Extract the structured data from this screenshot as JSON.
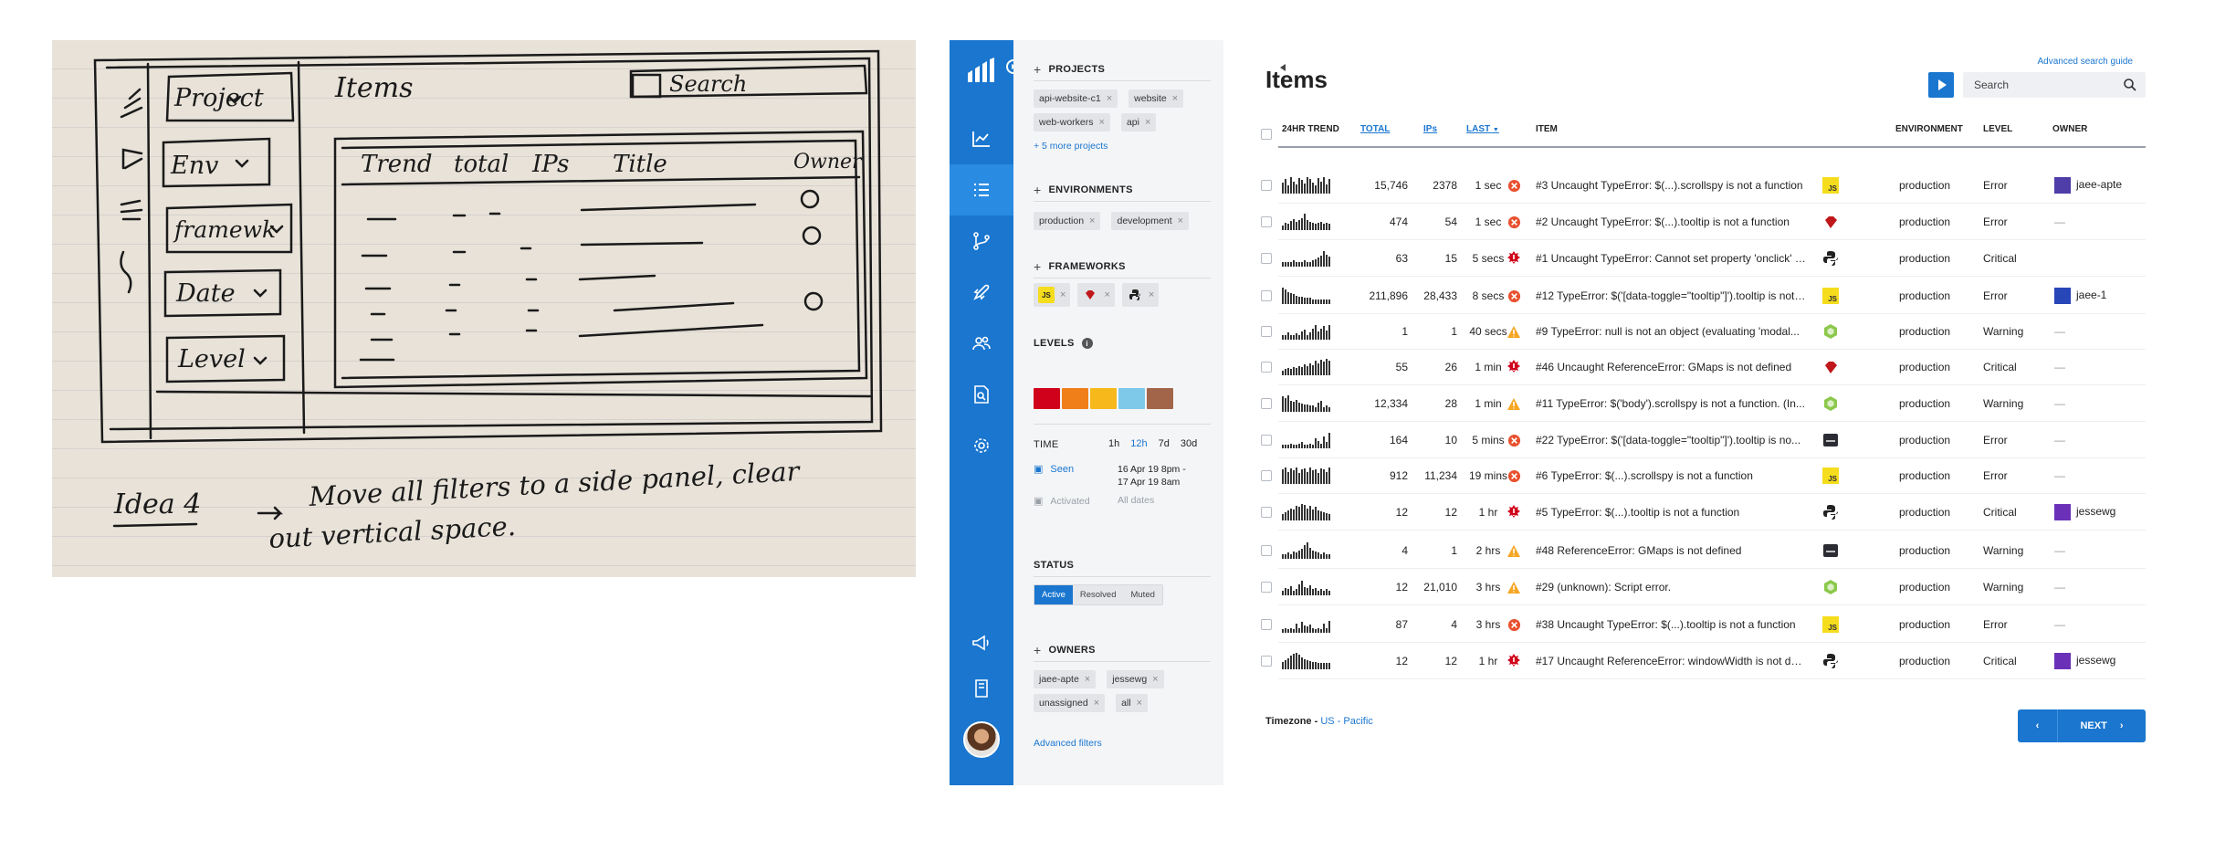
{
  "sketch": {
    "nav": [
      "Project",
      "Env",
      "framewk",
      "Date",
      "Level"
    ],
    "title": "Items",
    "search": "Search",
    "columns": [
      "Trend",
      "total",
      "IPs",
      "Title",
      "Owner"
    ],
    "idea_label": "Idea 4",
    "idea_line1": "Move all filters to a side panel, clear",
    "idea_line2": "out vertical space."
  },
  "filters": {
    "projects": {
      "title": "PROJECTS",
      "chips": [
        "api-website-c1",
        "website",
        "web-workers",
        "api"
      ],
      "more": "+ 5 more projects"
    },
    "environments": {
      "title": "ENVIRONMENTS",
      "chips": [
        "production",
        "development"
      ]
    },
    "frameworks": {
      "title": "FRAMEWORKS",
      "chips": [
        "js",
        "ruby",
        "python"
      ]
    },
    "levels": {
      "title": "LEVELS",
      "colors": [
        "#d0021b",
        "#f07f1a",
        "#f6b81b",
        "#7ec8ea",
        "#a3654a"
      ]
    },
    "time": {
      "title": "TIME",
      "options": [
        "1h",
        "12h",
        "7d",
        "30d"
      ],
      "seen_label": "Seen",
      "seen_from": "16 Apr 19  8pm -",
      "seen_to": "17 Apr 19  8am",
      "activated_label": "Activated",
      "activated_value": "All dates"
    },
    "status": {
      "title": "STATUS",
      "options": [
        "Active",
        "Resolved",
        "Muted"
      ]
    },
    "owners": {
      "title": "OWNERS",
      "chips": [
        "jaee-apte",
        "jessewg",
        "unassigned",
        "all"
      ]
    },
    "advanced": "Advanced filters"
  },
  "main": {
    "title": "Items",
    "advanced_guide": "Advanced search guide",
    "search_placeholder": "Search",
    "columns": {
      "trend": "24HR TREND",
      "total": "TOTAL",
      "ips": "IPs",
      "last": "LAST",
      "item": "ITEM",
      "environment": "ENVIRONMENT",
      "level": "LEVEL",
      "owner": "OWNER"
    },
    "rows": [
      {
        "total": "15,746",
        "ips": "2378",
        "last": "1 sec",
        "icon": "error",
        "title": "#3 Uncaught TypeError: $(...).scrollspy is not a function",
        "fw": "js",
        "env": "production",
        "level": "Error",
        "owner": "jaee-apte",
        "trend": [
          9,
          12,
          6,
          14,
          10,
          7,
          13,
          11,
          8,
          14,
          12,
          9,
          6,
          13,
          10,
          14,
          7,
          12
        ]
      },
      {
        "total": "474",
        "ips": "54",
        "last": "1 sec",
        "icon": "error",
        "title": "#2 Uncaught TypeError: $(...).tooltip is not a function",
        "fw": "ruby",
        "env": "production",
        "level": "Error",
        "owner": "—",
        "trend": [
          3,
          5,
          4,
          7,
          9,
          6,
          8,
          10,
          14,
          8,
          6,
          5,
          4,
          5,
          6,
          4,
          5,
          4
        ]
      },
      {
        "total": "63",
        "ips": "15",
        "last": "5 secs",
        "icon": "critical",
        "title": "#1 Uncaught TypeError: Cannot set property 'onclick' of...",
        "fw": "python",
        "env": "production",
        "level": "Critical",
        "owner": "",
        "trend": [
          3,
          3,
          3,
          3,
          4,
          3,
          3,
          3,
          4,
          3,
          3,
          4,
          5,
          7,
          9,
          13,
          10,
          8
        ]
      },
      {
        "total": "211,896",
        "ips": "28,433",
        "last": "8 secs",
        "icon": "error",
        "title": "#12 TypeError: $('[data-toggle=\"tooltip\"]').tooltip is not a...",
        "fw": "js",
        "env": "production",
        "level": "Error",
        "owner": "jaee-1",
        "trend": [
          14,
          12,
          10,
          9,
          8,
          6,
          5,
          5,
          4,
          4,
          4,
          3,
          3,
          3,
          3,
          3,
          3,
          3
        ]
      },
      {
        "total": "1",
        "ips": "1",
        "last": "40 secs",
        "icon": "warning",
        "title": "#9 TypeError: null is not an object (evaluating 'modal...",
        "fw": "node",
        "env": "production",
        "level": "Warning",
        "owner": "—",
        "trend": [
          3,
          3,
          5,
          3,
          3,
          4,
          3,
          6,
          8,
          3,
          5,
          9,
          12,
          6,
          9,
          11,
          7,
          12
        ]
      },
      {
        "total": "55",
        "ips": "26",
        "last": "1 min",
        "icon": "critical",
        "title": "#46 Uncaught ReferenceError: GMaps is not defined",
        "fw": "ruby",
        "env": "production",
        "level": "Critical",
        "owner": "—",
        "trend": [
          3,
          4,
          5,
          4,
          6,
          5,
          7,
          6,
          9,
          7,
          10,
          8,
          12,
          10,
          13,
          11,
          14,
          12
        ]
      },
      {
        "total": "12,334",
        "ips": "28",
        "last": "1 min",
        "icon": "warning",
        "title": "#11 TypeError: $('body').scrollspy is not a function. (In...",
        "fw": "node",
        "env": "production",
        "level": "Warning",
        "owner": "—",
        "trend": [
          13,
          11,
          14,
          9,
          8,
          10,
          7,
          6,
          5,
          5,
          4,
          4,
          3,
          7,
          9,
          3,
          4,
          3
        ]
      },
      {
        "total": "164",
        "ips": "10",
        "last": "5 mins",
        "icon": "error",
        "title": "#22 TypeError: $('[data-toggle=\"tooltip\"]').tooltip is no...",
        "fw": "terminal",
        "env": "production",
        "level": "Error",
        "owner": "—",
        "trend": [
          2,
          2,
          2,
          3,
          2,
          2,
          3,
          4,
          2,
          2,
          3,
          2,
          8,
          5,
          3,
          10,
          4,
          13
        ]
      },
      {
        "total": "912",
        "ips": "11,234",
        "last": "19 mins",
        "icon": "error",
        "title": "#6 TypeError: $(...).scrollspy is not a function",
        "fw": "js",
        "env": "production",
        "level": "Error",
        "owner": "—",
        "trend": [
          12,
          14,
          10,
          13,
          11,
          14,
          9,
          12,
          13,
          10,
          14,
          11,
          12,
          9,
          13,
          12,
          10,
          14
        ]
      },
      {
        "total": "12",
        "ips": "12",
        "last": "1 hr",
        "icon": "critical",
        "title": "#5 TypeError: $(...).tooltip is not a function",
        "fw": "python",
        "env": "production",
        "level": "Critical",
        "owner": "jessewg",
        "trend": [
          4,
          6,
          8,
          10,
          9,
          12,
          11,
          14,
          13,
          10,
          12,
          9,
          11,
          8,
          7,
          6,
          5,
          4
        ]
      },
      {
        "total": "4",
        "ips": "1",
        "last": "2 hrs",
        "icon": "warning",
        "title": "#48 ReferenceError: GMaps is not defined",
        "fw": "terminal",
        "env": "production",
        "level": "Warning",
        "owner": "—",
        "trend": [
          3,
          3,
          4,
          3,
          5,
          4,
          6,
          8,
          11,
          14,
          9,
          6,
          5,
          4,
          3,
          4,
          3,
          3
        ]
      },
      {
        "total": "12",
        "ips": "21,010",
        "last": "3 hrs",
        "icon": "warning",
        "title": "#29 (unknown): Script error.",
        "fw": "node",
        "env": "production",
        "level": "Warning",
        "owner": "—",
        "trend": [
          3,
          5,
          4,
          7,
          3,
          4,
          9,
          12,
          6,
          5,
          8,
          4,
          5,
          3,
          4,
          3,
          4,
          3
        ]
      },
      {
        "total": "87",
        "ips": "4",
        "last": "3 hrs",
        "icon": "error",
        "title": "#38 Uncaught TypeError: $(...).tooltip is not a function",
        "fw": "js",
        "env": "production",
        "level": "Error",
        "owner": "—",
        "trend": [
          2,
          3,
          2,
          3,
          2,
          7,
          3,
          9,
          5,
          4,
          6,
          3,
          2,
          3,
          2,
          7,
          3,
          10
        ]
      },
      {
        "total": "12",
        "ips": "12",
        "last": "1 hr",
        "icon": "critical",
        "title": "#17 Uncaught ReferenceError: windowWidth is not de...",
        "fw": "python",
        "env": "production",
        "level": "Critical",
        "owner": "jessewg",
        "trend": [
          5,
          7,
          9,
          11,
          13,
          14,
          12,
          10,
          8,
          7,
          6,
          5,
          5,
          4,
          4,
          4,
          4,
          4
        ]
      }
    ],
    "timezone_label": "Timezone - ",
    "timezone_value": "US - Pacific",
    "next_label": "NEXT"
  }
}
